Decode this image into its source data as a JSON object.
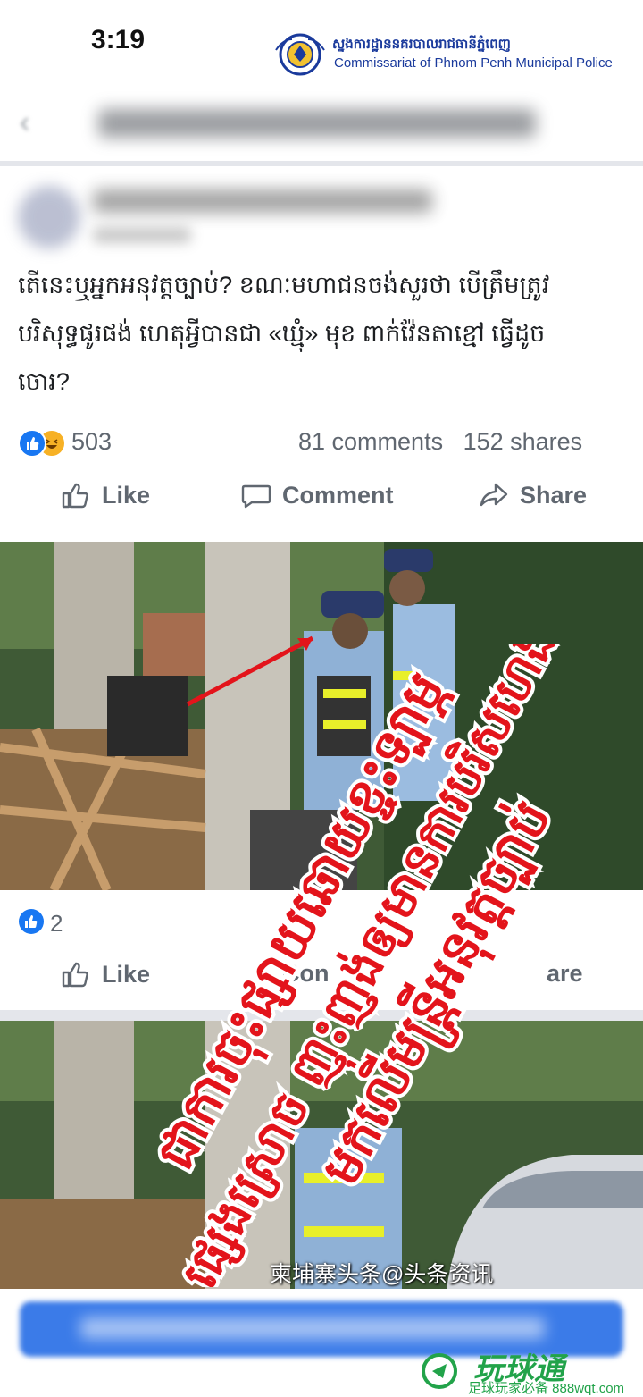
{
  "status_bar": {
    "time": "3:19"
  },
  "watermark_top": {
    "org_khmer": "ស្នងការដ្ឋាននគរបាលរាជធានីភ្នំពេញ",
    "org_english": "Commissariat of Phnom Penh Municipal Police"
  },
  "post": {
    "text_lines": [
      "តើនេះឬអ្នកអនុវត្តច្បាប់? ខណៈមហាជនចង់សួរថា បើត្រឹមត្រូវ",
      "បរិសុទ្ធផូរផង់ ហេតុអ្វីបានជា «ឃ្មុំ» មុខ ពាក់វ៉ែនតាខ្មៅ ធ្វើដូច",
      "ចោរ?"
    ],
    "reaction_count": "503",
    "comments": "81 comments",
    "shares": "152 shares",
    "actions": {
      "like": "Like",
      "comment": "Comment",
      "share": "Share"
    }
  },
  "second_post": {
    "reaction_count": "2",
    "actions": {
      "like": "Like",
      "comment": "Con",
      "share": "are"
    }
  },
  "overlay_text": {
    "line1": "ជាការចុះផ្សាយឆោយខ្ចះទ្បាម្ភ",
    "line2": "ផ្សេងស្រោច ញុះញង់ឲ្យមានការបរិសហេង",
    "line3": "មកលើមន្ត្រីអនុវត្តច្បាប់"
  },
  "credit": "柬埔寨头条@头条资讯",
  "watermark_bottom": {
    "title": "玩球通",
    "subtitle": "足球玩家必备 888wqt.com"
  },
  "colors": {
    "facebook_blue": "#1877f2",
    "overlay_red": "#e3141b",
    "watermark_green": "#22a34a"
  }
}
